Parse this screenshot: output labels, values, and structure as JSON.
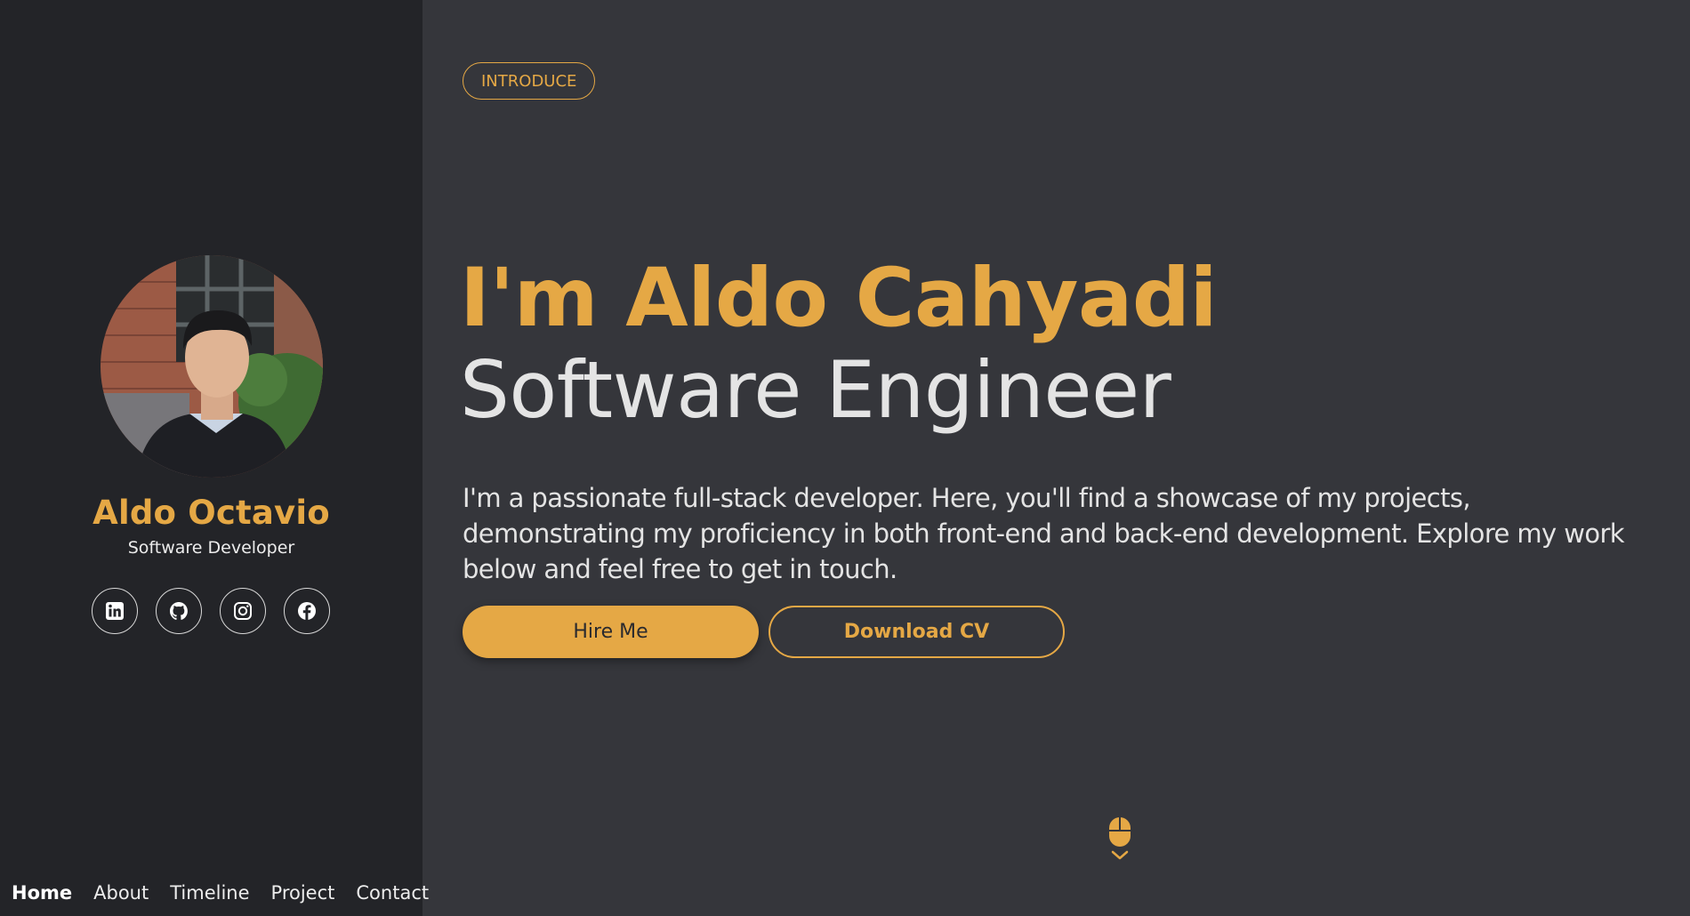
{
  "sidebar": {
    "profile": {
      "name": "Aldo Octavio",
      "role": "Software Developer"
    },
    "social_links": [
      {
        "icon": "linkedin-icon"
      },
      {
        "icon": "github-icon"
      },
      {
        "icon": "instagram-icon"
      },
      {
        "icon": "facebook-icon"
      }
    ],
    "nav": [
      {
        "label": "Home",
        "active": true
      },
      {
        "label": "About",
        "active": false
      },
      {
        "label": "Timeline",
        "active": false
      },
      {
        "label": "Project",
        "active": false
      },
      {
        "label": "Contact",
        "active": false
      }
    ]
  },
  "hero": {
    "badge": "INTRODUCE",
    "name_line": "I'm Aldo Cahyadi",
    "role_line": "Software Engineer",
    "description": "I'm a passionate full-stack developer. Here, you'll find a showcase of my projects, demonstrating my proficiency in both front-end and back-end development. Explore my work below and feel free to get in touch.",
    "hire_button": "Hire Me",
    "cv_button": "Download CV",
    "scroll_icon": "mouse-scroll-icon"
  },
  "colors": {
    "accent": "#e5a845",
    "sidebar_bg": "#232428",
    "main_bg": "#35363b",
    "text": "#e4e4e4"
  }
}
